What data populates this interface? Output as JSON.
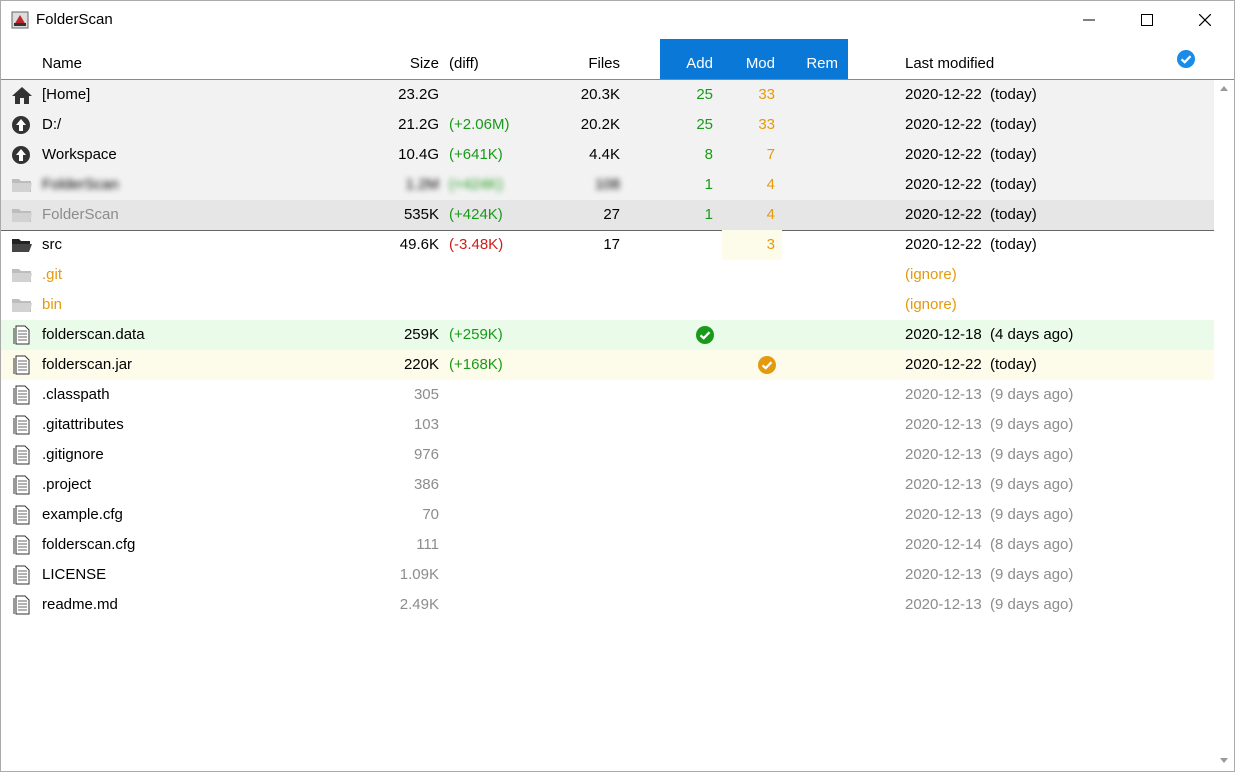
{
  "window": {
    "title": "FolderScan"
  },
  "header": {
    "name": "Name",
    "size": "Size",
    "diff": "(diff)",
    "files": "Files",
    "add": "Add",
    "mod": "Mod",
    "rem": "Rem",
    "last_modified": "Last modified"
  },
  "parents": [
    {
      "icon": "home-icon",
      "name": "[Home]",
      "size": "23.2G",
      "diff": "",
      "files": "20.3K",
      "add": "25",
      "mod": "33",
      "date": "2020-12-22",
      "ago": "(today)"
    },
    {
      "icon": "up-arrow-icon",
      "name": "D:/",
      "size": "21.2G",
      "diff": "(+2.06M)",
      "files": "20.2K",
      "add": "25",
      "mod": "33",
      "date": "2020-12-22",
      "ago": "(today)"
    },
    {
      "icon": "up-arrow-icon",
      "name": "Workspace",
      "size": "10.4G",
      "diff": "(+641K)",
      "files": "4.4K",
      "add": "8",
      "mod": "7",
      "date": "2020-12-22",
      "ago": "(today)"
    },
    {
      "icon": "folder-icon",
      "name": "FolderScan",
      "size": "1.2M",
      "diff": "(+424K)",
      "files": "108",
      "add": "1",
      "mod": "4",
      "date": "2020-12-22",
      "ago": "(today)"
    },
    {
      "icon": "folder-icon",
      "name": "FolderScan",
      "size": "535K",
      "diff": "(+424K)",
      "files": "27",
      "add": "1",
      "mod": "4",
      "date": "2020-12-22",
      "ago": "(today)"
    }
  ],
  "items": [
    {
      "icon": "folder-open-icon",
      "name": "src",
      "size": "49.6K",
      "diff": "(-3.48K)",
      "files": "17",
      "add": "",
      "mod": "3",
      "date": "2020-12-22",
      "ago": "(today)"
    },
    {
      "icon": "folder-icon",
      "name": ".git",
      "ignore": "(ignore)"
    },
    {
      "icon": "folder-icon",
      "name": "bin",
      "ignore": "(ignore)"
    },
    {
      "icon": "file-icon",
      "name": "folderscan.data",
      "size": "259K",
      "diff": "(+259K)",
      "mark": "added",
      "date": "2020-12-18",
      "ago": "(4 days ago)"
    },
    {
      "icon": "file-icon",
      "name": "folderscan.jar",
      "size": "220K",
      "diff": "(+168K)",
      "mark": "modified",
      "date": "2020-12-22",
      "ago": "(today)"
    },
    {
      "icon": "file-icon",
      "name": ".classpath",
      "size": "305",
      "date": "2020-12-13",
      "ago": "(9 days ago)"
    },
    {
      "icon": "file-icon",
      "name": ".gitattributes",
      "size": "103",
      "date": "2020-12-13",
      "ago": "(9 days ago)"
    },
    {
      "icon": "file-icon",
      "name": ".gitignore",
      "size": "976",
      "date": "2020-12-13",
      "ago": "(9 days ago)"
    },
    {
      "icon": "file-icon",
      "name": ".project",
      "size": "386",
      "date": "2020-12-13",
      "ago": "(9 days ago)"
    },
    {
      "icon": "file-icon",
      "name": "example.cfg",
      "size": "70",
      "date": "2020-12-13",
      "ago": "(9 days ago)"
    },
    {
      "icon": "file-icon",
      "name": "folderscan.cfg",
      "size": "111",
      "date": "2020-12-14",
      "ago": "(8 days ago)"
    },
    {
      "icon": "file-icon",
      "name": "LICENSE",
      "size": "1.09K",
      "date": "2020-12-13",
      "ago": "(9 days ago)"
    },
    {
      "icon": "file-icon",
      "name": "readme.md",
      "size": "2.49K",
      "date": "2020-12-13",
      "ago": "(9 days ago)"
    }
  ],
  "colors": {
    "accent": "#0a78d7",
    "added": "#1a9a1a",
    "modified": "#e39a0e",
    "removed": "#d21b1b",
    "added_bg": "#eafbea",
    "modified_bg": "#fdfbea"
  }
}
